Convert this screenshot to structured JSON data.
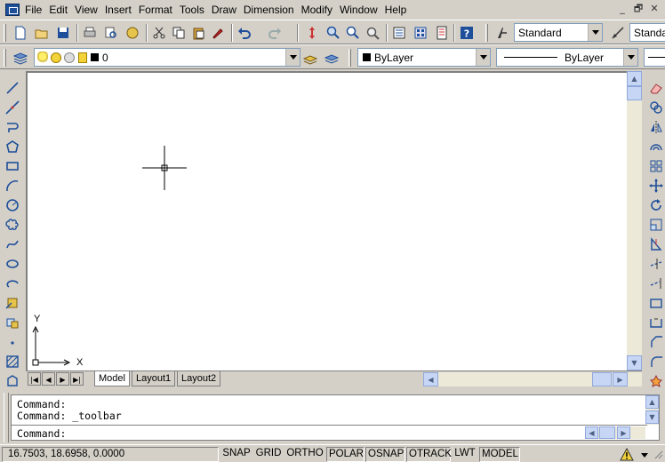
{
  "menu": [
    "File",
    "Edit",
    "View",
    "Insert",
    "Format",
    "Tools",
    "Draw",
    "Dimension",
    "Modify",
    "Window",
    "Help"
  ],
  "window_controls": [
    "_",
    "🗗",
    "✕"
  ],
  "toolbar": {
    "text_style": "Standard",
    "dim_style": "Standar"
  },
  "layers": {
    "current_layer": "0",
    "color": "ByLayer",
    "linetype": "ByLayer"
  },
  "ucs": {
    "y_label": "Y",
    "x_label": "X"
  },
  "tabs": {
    "model": "Model",
    "layout1": "Layout1",
    "layout2": "Layout2"
  },
  "command": {
    "line1": "Command:",
    "line2": "Command: _toolbar",
    "prompt": "Command:"
  },
  "status": {
    "coords": "16.7503, 18.6958, 0.0000",
    "snap": "SNAP",
    "grid": "GRID",
    "ortho": "ORTHO",
    "polar": "POLAR",
    "osnap": "OSNAP",
    "otrack": "OTRACK",
    "lwt": "LWT",
    "model": "MODEL"
  },
  "colors": {
    "background": "#d4d0c8",
    "canvas": "#ffffff",
    "icon_blue": "#1e4f9a"
  }
}
